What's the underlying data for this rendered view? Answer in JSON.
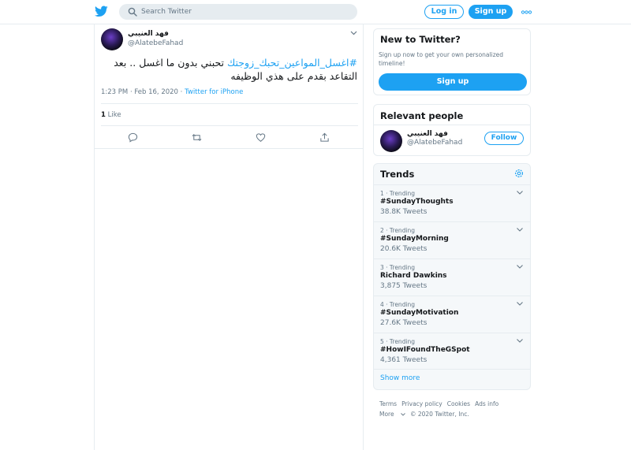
{
  "search": {
    "placeholder": "Search Twitter"
  },
  "header": {
    "login_label": "Log in",
    "signup_label": "Sign up"
  },
  "tweet": {
    "author_name": "فهد العنيبي",
    "author_handle": "@AlatebeFahad",
    "hashtag": "#اغسل_المواعين_تحبك_زوجتك",
    "text": " تحبني بدون ما اغسل .. بعد التقاعد بقدم على هذي الوظيفه",
    "time": "1:23 PM · Feb 16, 2020 · ",
    "source": "Twitter for iPhone",
    "like_count": "1",
    "like_label": "Like"
  },
  "new_to_twitter": {
    "title": "New to Twitter?",
    "subtitle": "Sign up now to get your own personalized timeline!",
    "signup_label": "Sign up"
  },
  "relevant_people": {
    "title": "Relevant people",
    "name": "فهد العنيبي",
    "handle": "@AlatebeFahad",
    "follow_label": "Follow"
  },
  "trends": {
    "title": "Trends",
    "items": [
      {
        "meta": "1 · Trending",
        "name": "#SundayThoughts",
        "count": "38.8K Tweets"
      },
      {
        "meta": "2 · Trending",
        "name": "#SundayMorning",
        "count": "20.6K Tweets"
      },
      {
        "meta": "3 · Trending",
        "name": "Richard Dawkins",
        "count": "3,875 Tweets"
      },
      {
        "meta": "4 · Trending",
        "name": "#SundayMotivation",
        "count": "27.6K Tweets"
      },
      {
        "meta": "5 · Trending",
        "name": "#HowIFoundTheGSpot",
        "count": "4,361 Tweets"
      }
    ],
    "show_more": "Show more"
  },
  "footer": {
    "terms": "Terms",
    "privacy": "Privacy policy",
    "cookies": "Cookies",
    "ads": "Ads info",
    "more": "More",
    "copyright": "© 2020 Twitter, Inc."
  },
  "colors": {
    "accent": "#1da1f2",
    "text": "#14171a",
    "muted": "#657786",
    "border": "#e6ecf0"
  }
}
